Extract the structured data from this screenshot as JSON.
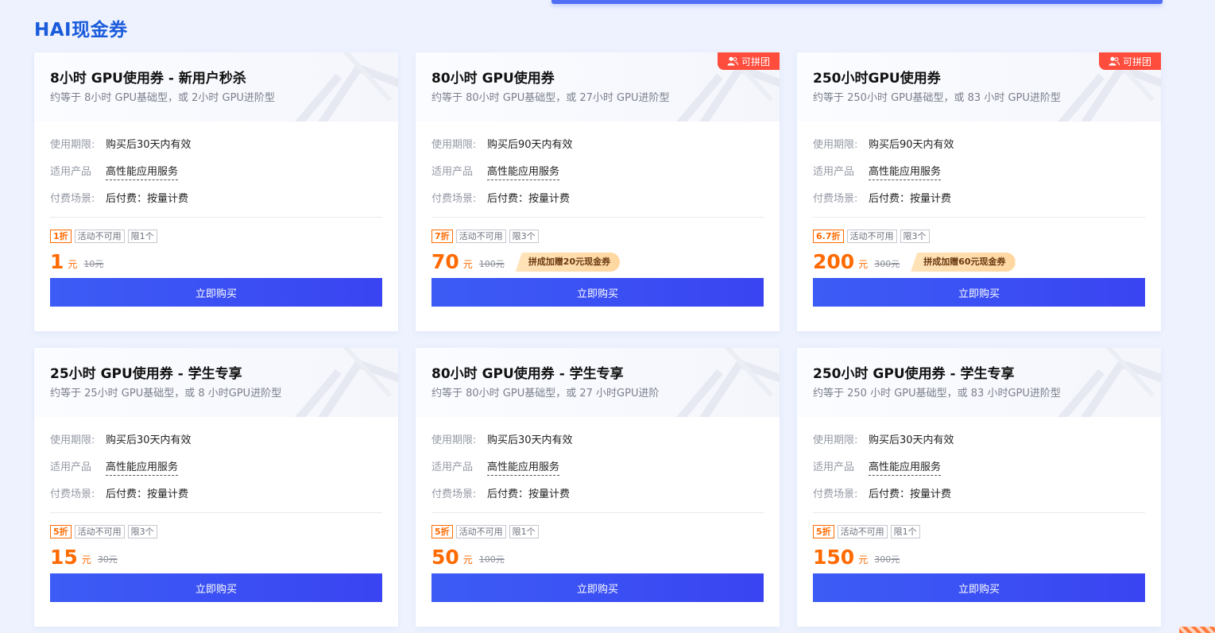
{
  "section_title": "HAI现金券",
  "labels": {
    "validity": "使用期限:",
    "product": "适用产品",
    "payment": "付费场景:",
    "buy": "立即购买",
    "activity_na": "活动不可用",
    "unit": "元"
  },
  "colors": {
    "accent_blue": "#3c5cf5",
    "title_blue": "#1a5bdc",
    "price_orange": "#ff6a00",
    "badge_red": "#ff4d3d"
  },
  "cards": [
    {
      "title": "8小时 GPU使用券 - 新用户秒杀",
      "subtitle": "约等于 8小时 GPU基础型，或 2小时 GPU进阶型",
      "validity": "购买后30天内有效",
      "product": "高性能应用服务",
      "payment": "后付费：按量计费",
      "discount": "1折",
      "limit": "限1个",
      "price": "1",
      "original": "10元",
      "group_badge": "",
      "promo": ""
    },
    {
      "title": "80小时 GPU使用券",
      "subtitle": "约等于 80小时 GPU基础型，或 27小时 GPU进阶型",
      "validity": "购买后90天内有效",
      "product": "高性能应用服务",
      "payment": "后付费：按量计费",
      "discount": "7折",
      "limit": "限3个",
      "price": "70",
      "original": "100元",
      "group_badge": "可拼团",
      "promo": "拼成加赠20元现金券"
    },
    {
      "title": "250小时GPU使用券",
      "subtitle": "约等于 250小时 GPU基础型，或 83 小时 GPU进阶型",
      "validity": "购买后90天内有效",
      "product": "高性能应用服务",
      "payment": "后付费：按量计费",
      "discount": "6.7折",
      "limit": "限3个",
      "price": "200",
      "original": "300元",
      "group_badge": "可拼团",
      "promo": "拼成加赠60元现金券"
    },
    {
      "title": "25小时 GPU使用券 - 学生专享",
      "subtitle": "约等于 25小时 GPU基础型，或 8 小时GPU进阶型",
      "validity": "购买后30天内有效",
      "product": "高性能应用服务",
      "payment": "后付费：按量计费",
      "discount": "5折",
      "limit": "限3个",
      "price": "15",
      "original": "30元",
      "group_badge": "",
      "promo": ""
    },
    {
      "title": "80小时 GPU使用券 - 学生专享",
      "subtitle": "约等于 80小时 GPU基础型，或 27 小时GPU进阶",
      "validity": "购买后30天内有效",
      "product": "高性能应用服务",
      "payment": "后付费：按量计费",
      "discount": "5折",
      "limit": "限1个",
      "price": "50",
      "original": "100元",
      "group_badge": "",
      "promo": ""
    },
    {
      "title": "250小时 GPU使用券 - 学生专享",
      "subtitle": "约等于 250 小时 GPU基础型，或 83 小时GPU进阶型",
      "validity": "购买后30天内有效",
      "product": "高性能应用服务",
      "payment": "后付费：按量计费",
      "discount": "5折",
      "limit": "限1个",
      "price": "150",
      "original": "300元",
      "group_badge": "",
      "promo": ""
    }
  ]
}
